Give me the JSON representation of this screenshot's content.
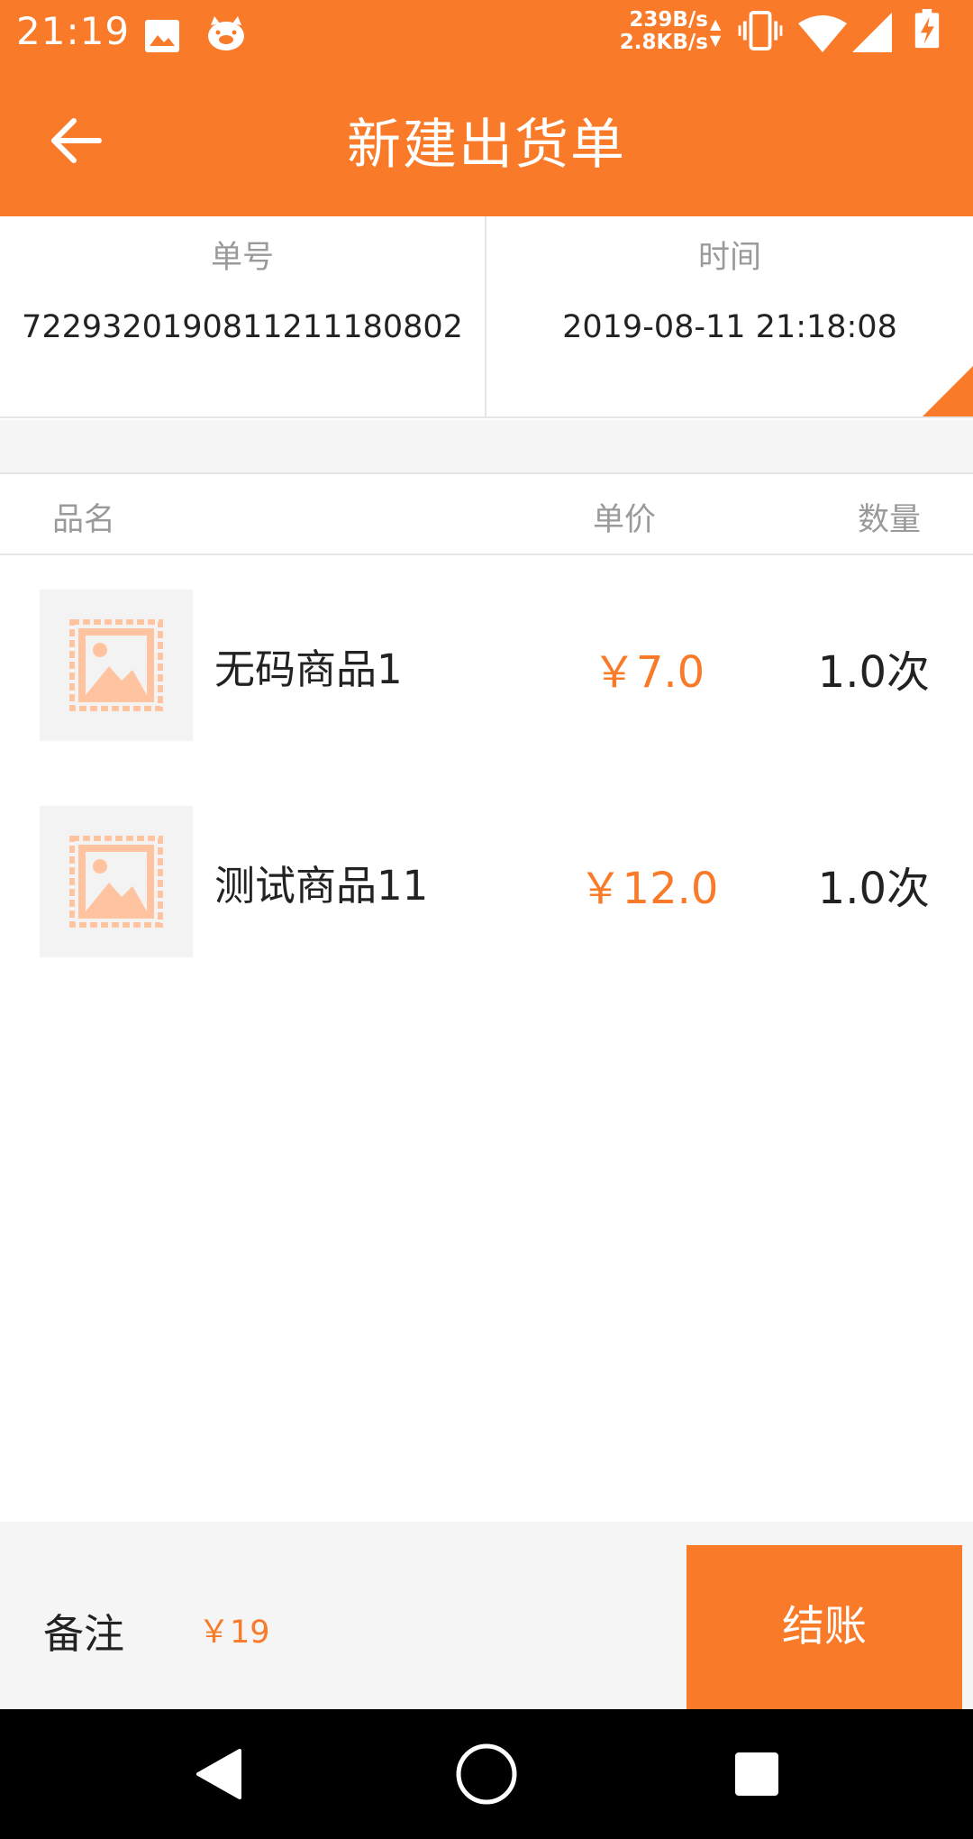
{
  "status_bar": {
    "time": "21:19",
    "net_up": "239B/s",
    "net_down": "2.8KB/s",
    "icons": [
      "image-icon",
      "notification-app-icon",
      "vibrate-icon",
      "wifi-icon",
      "signal-icon",
      "battery-charging-icon"
    ]
  },
  "app_bar": {
    "title": "新建出货单",
    "back_icon": "arrow-left-icon"
  },
  "order_info": {
    "number_label": "单号",
    "number_value": "7229320190811211180802",
    "time_label": "时间",
    "time_value": "2019-08-11 21:18:08"
  },
  "table": {
    "headers": {
      "name": "品名",
      "price": "单价",
      "qty": "数量"
    },
    "rows": [
      {
        "name": "无码商品1",
        "price": "￥7.0",
        "qty": "1.0次",
        "image": "image-placeholder-icon"
      },
      {
        "name": "测试商品11",
        "price": "￥12.0",
        "qty": "1.0次",
        "image": "image-placeholder-icon"
      }
    ]
  },
  "bottom_bar": {
    "remark_label": "备注",
    "total": "￥19",
    "checkout_label": "结账"
  },
  "colors": {
    "accent": "#f97a28",
    "placeholder": "#ffc3a0"
  },
  "nav_bar": {
    "icons": [
      "nav-back-icon",
      "nav-home-icon",
      "nav-recents-icon"
    ]
  }
}
